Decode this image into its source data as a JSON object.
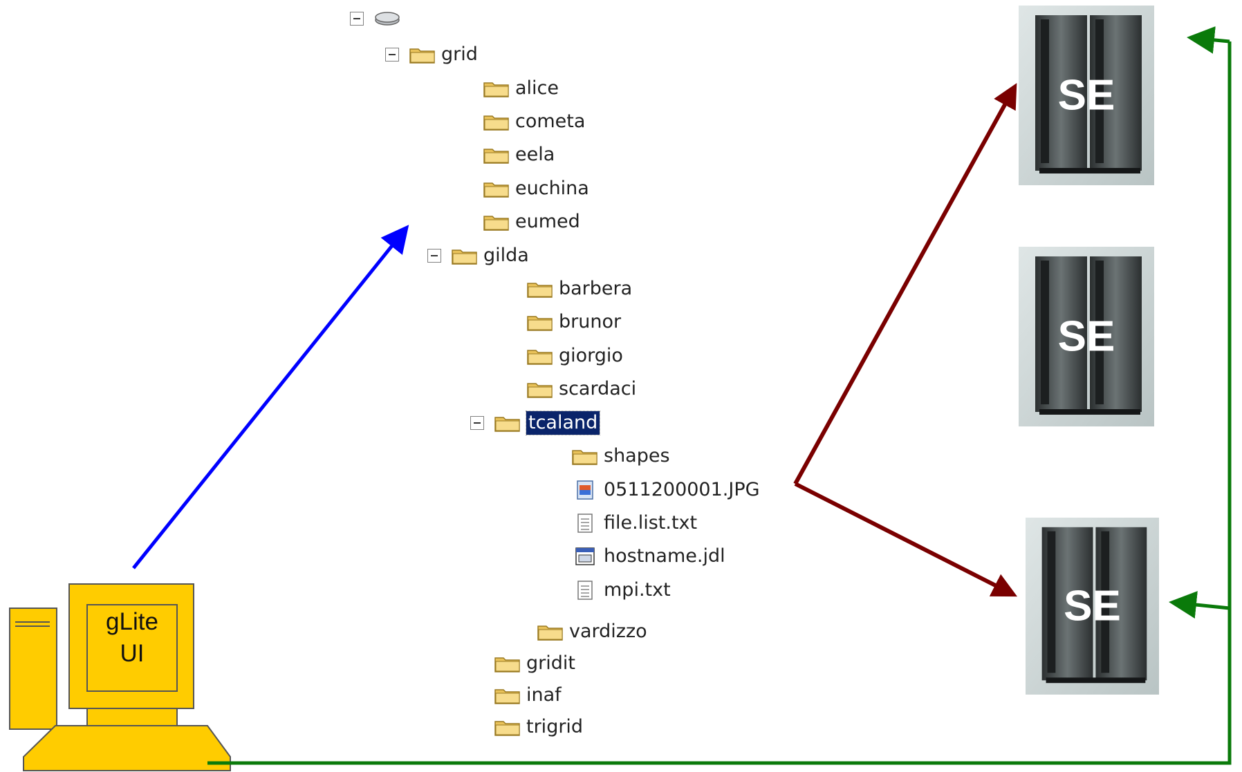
{
  "tree": {
    "items": [
      {
        "label": "",
        "icon": "drive-icon",
        "toggle": true
      },
      {
        "label": "grid",
        "icon": "folder-icon",
        "toggle": true
      },
      {
        "label": "alice",
        "icon": "folder-icon"
      },
      {
        "label": "cometa",
        "icon": "folder-icon"
      },
      {
        "label": "eela",
        "icon": "folder-icon"
      },
      {
        "label": "euchina",
        "icon": "folder-icon"
      },
      {
        "label": "eumed",
        "icon": "folder-icon"
      },
      {
        "label": "gilda",
        "icon": "folder-icon",
        "toggle": true
      },
      {
        "label": "barbera",
        "icon": "folder-icon"
      },
      {
        "label": "brunor",
        "icon": "folder-icon"
      },
      {
        "label": "giorgio",
        "icon": "folder-icon"
      },
      {
        "label": "scardaci",
        "icon": "folder-icon"
      },
      {
        "label": "tcaland",
        "icon": "folder-icon",
        "toggle": true,
        "selected": true
      },
      {
        "label": "shapes",
        "icon": "folder-icon"
      },
      {
        "label": "0511200001.JPG",
        "icon": "image-file-icon"
      },
      {
        "label": "file.list.txt",
        "icon": "text-file-icon"
      },
      {
        "label": "hostname.jdl",
        "icon": "jdl-file-icon"
      },
      {
        "label": "mpi.txt",
        "icon": "text-file-icon"
      },
      {
        "label": "vardizzo",
        "icon": "folder-icon"
      },
      {
        "label": "gridit",
        "icon": "folder-icon"
      },
      {
        "label": "inaf",
        "icon": "folder-icon"
      },
      {
        "label": "trigrid",
        "icon": "folder-icon"
      }
    ]
  },
  "storage_elements": [
    {
      "label": "SE"
    },
    {
      "label": "SE"
    },
    {
      "label": "SE"
    }
  ],
  "computer": {
    "line1": "gLite",
    "line2": "UI"
  },
  "colors": {
    "blue_arrow": "#0000ff",
    "red_arrow": "#7a0000",
    "green_arrow": "#0a7a0a",
    "computer": "#ffcc00"
  }
}
